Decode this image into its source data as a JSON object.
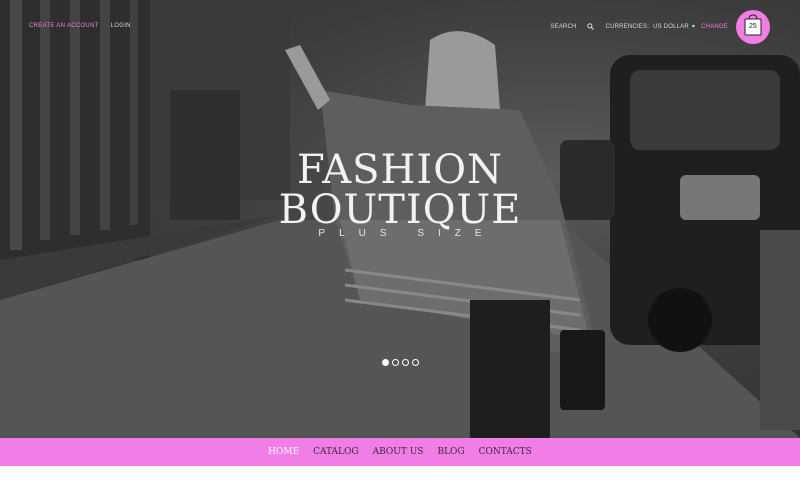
{
  "topbar": {
    "create_account": "CREATE AN ACCOUNT",
    "login": "LOGIN",
    "search": "SEARCH",
    "currencies_label": "CURRENCIES:",
    "currency_value": "US DOLLAR",
    "change": "CHANGE"
  },
  "cart": {
    "count": "25"
  },
  "hero": {
    "title_line1": "FASHION",
    "title_line2": "BOUTIQUE",
    "subtitle": "PLUS SIZE",
    "slides": 4,
    "active_slide": 1
  },
  "nav": {
    "items": [
      "HOME",
      "CATALOG",
      "ABOUT US",
      "BLOG",
      "CONTACTS"
    ],
    "active": "HOME"
  },
  "colors": {
    "accent": "#f07ee6",
    "text_light": "#f2f2f2"
  },
  "icons": [
    "search-icon",
    "cart-icon",
    "chevron-down-icon"
  ]
}
